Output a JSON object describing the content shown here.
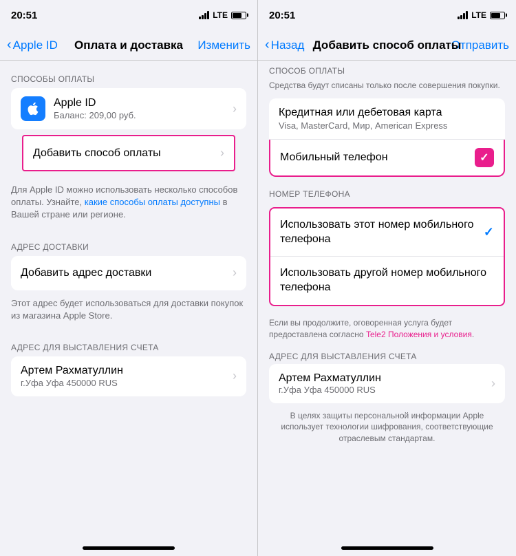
{
  "left_screen": {
    "status_bar": {
      "time": "20:51",
      "signal": "LTE",
      "battery_level": 70
    },
    "nav": {
      "back_label": "Apple ID",
      "title": "Оплата и доставка",
      "action": "Изменить"
    },
    "sections": {
      "payment_methods": {
        "header": "СПОСОБЫ ОПЛАТЫ",
        "apple_id_item": {
          "title": "Apple ID",
          "subtitle": "Баланс: 209,00 руб."
        },
        "add_payment": "Добавить способ оплаты"
      },
      "info_text": "Для Apple ID можно использовать несколько способов оплаты. Узнайте, какие способы оплаты доступны в Вашей стране или регионе.",
      "info_link": "какие способы оплаты доступны",
      "delivery_address": {
        "header": "АДРЕС ДОСТАВКИ",
        "add_label": "Добавить адрес доставки"
      },
      "delivery_info": "Этот адрес будет использоваться для доставки покупок из магазина Apple Store.",
      "billing_address": {
        "header": "АДРЕС ДЛЯ ВЫСТАВЛЕНИЯ СЧЕТА",
        "name": "Артем Рахматуллин",
        "address": "г.Уфа Уфа 450000 RUS"
      }
    }
  },
  "right_screen": {
    "status_bar": {
      "time": "20:51",
      "signal": "LTE",
      "battery_level": 70
    },
    "nav": {
      "back_label": "Назад",
      "title": "Добавить способ оплаты",
      "action": "Отправить"
    },
    "sections": {
      "payment_method": {
        "header": "СПОСОБ ОПЛАТЫ",
        "info": "Средства будут списаны только после совершения покупки.",
        "credit_card": {
          "title": "Кредитная или дебетовая карта",
          "subtitle": "Visa, MasterCard, Мир, American Express"
        },
        "mobile_phone": "Мобильный телефон"
      },
      "phone_number": {
        "header": "НОМЕР ТЕЛЕФОНА",
        "options": [
          "Использовать этот номер мобильного телефона",
          "Использовать другой номер мобильного телефона"
        ]
      },
      "terms_text": "Если вы продолжите, оговоренная услуга будет предоставлена согласно",
      "terms_link": "Tele2 Положения и условия",
      "billing_address": {
        "header": "АДРЕС ДЛЯ ВЫСТАВЛЕНИЯ СЧЕТА",
        "name": "Артем Рахматуллин",
        "address": "г.Уфа Уфа 450000 RUS"
      },
      "security_text": "В целях защиты персональной информации Apple использует технологии шифрования, соответствующие отраслевым стандартам."
    }
  }
}
